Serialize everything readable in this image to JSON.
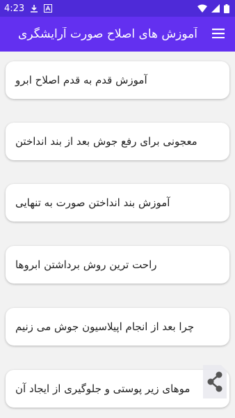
{
  "status_bar": {
    "time": "4:23",
    "icons": [
      "download-icon",
      "font-icon",
      "wifi-icon",
      "signal-icon",
      "battery-icon"
    ]
  },
  "app_bar": {
    "title": "آموزش های اصلاح صورت آرایشگری",
    "menu_icon": "menu-icon",
    "color": "#6330f0"
  },
  "list": {
    "items": [
      {
        "label": "آموزش قدم به قدم اصلاح ابرو"
      },
      {
        "label": "معجونی برای رفع جوش بعد از بند انداختن"
      },
      {
        "label": "آموزش بند انداختن صورت به تنهایی"
      },
      {
        "label": "راحت ترین روش برداشتن ابروها"
      },
      {
        "label": "چرا بعد از انجام اپیلاسیون جوش می زنیم"
      },
      {
        "label": "موهای زیر پوستی و جلوگیری از ایجاد آن"
      }
    ]
  },
  "fab": {
    "icon": "share-icon"
  }
}
